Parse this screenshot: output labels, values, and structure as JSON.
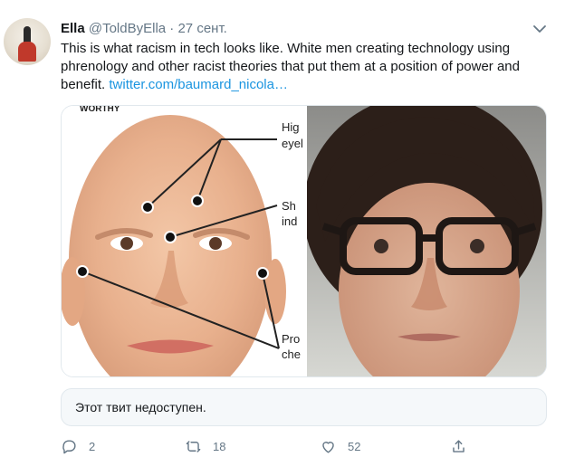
{
  "tweet": {
    "author_name": "Ella",
    "handle": "@ToldByElla",
    "separator": "·",
    "date": "27 сент.",
    "text": "This is what racism in tech looks like. White men creating technology using phrenology and other racist theories that put them at a position of power and benefit.",
    "link_text": "twitter.com/baumard_nicola…",
    "unavailable_text": "Этот твит недоступен.",
    "media": {
      "left_image": {
        "description_labels": [
          "Hig",
          "eyel",
          "Sh",
          "ind",
          "Pro",
          "che"
        ],
        "header_label": "WORTHY"
      },
      "right_image": {}
    },
    "actions": {
      "reply_count": "2",
      "retweet_count": "18",
      "like_count": "52"
    }
  },
  "colors": {
    "link": "#1b95e0",
    "secondary_text": "#657786",
    "border": "#e1e8ed"
  },
  "icons": [
    "caret-down-icon",
    "reply-icon",
    "retweet-icon",
    "like-icon",
    "share-icon"
  ]
}
